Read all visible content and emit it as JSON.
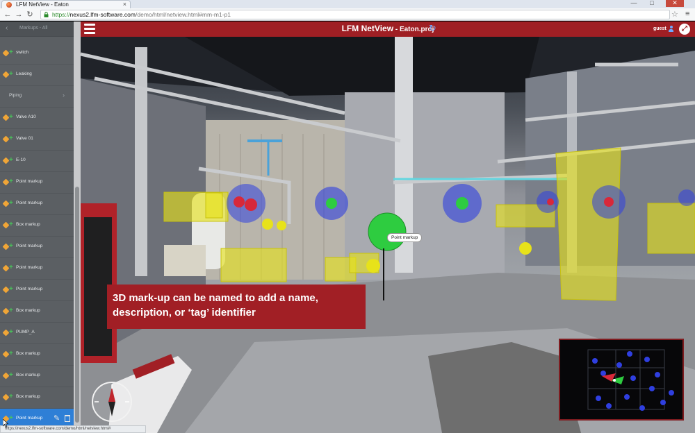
{
  "browser": {
    "tab_title": "LFM NetView - Eaton",
    "tab_close": "×",
    "url_scheme": "https://",
    "url_host": "nexus2.lfm-software.com",
    "url_rest": "/demo/html/netview.html#mm-m1-p1",
    "window_minimize": "—",
    "window_maximize": "□",
    "window_close": "✕",
    "back": "←",
    "forward": "→",
    "reload": "↻",
    "star": "☆",
    "menu": "≡"
  },
  "app": {
    "title": "LFM NetView",
    "separator": " - ",
    "project": "Eaton.proj",
    "refresh_glyph": "↻",
    "user": "guest",
    "fullscreen_glyph": "⤢"
  },
  "sidebar": {
    "back_glyph": "‹",
    "breadcrumb": "Markups - All",
    "items": [
      {
        "label": "switch",
        "type": "markup"
      },
      {
        "label": "Leaking",
        "type": "markup"
      },
      {
        "label": "Piping",
        "type": "category"
      },
      {
        "label": "Valve A10",
        "type": "markup"
      },
      {
        "label": "Valve 01",
        "type": "markup"
      },
      {
        "label": "E-10",
        "type": "markup"
      },
      {
        "label": "Point markup",
        "type": "markup"
      },
      {
        "label": "Point markup",
        "type": "markup"
      },
      {
        "label": "Box markup",
        "type": "markup"
      },
      {
        "label": "Point markup",
        "type": "markup"
      },
      {
        "label": "Point markup",
        "type": "markup"
      },
      {
        "label": "Point markup",
        "type": "markup"
      },
      {
        "label": "Box markup",
        "type": "markup"
      },
      {
        "label": "PUMP_A",
        "type": "markup"
      },
      {
        "label": "Box markup",
        "type": "markup"
      },
      {
        "label": "Box markup",
        "type": "markup"
      },
      {
        "label": "Box markup",
        "type": "markup"
      },
      {
        "label": "Point markup",
        "type": "markup",
        "selected": true
      }
    ],
    "plus_glyph": "+",
    "chevron_glyph": "›",
    "edit_glyph": "✎"
  },
  "viewport": {
    "tooltip": "Point markup",
    "caption_line1": "3D mark-up can be named to add a name,",
    "caption_line2": "description, or ‘tag’ identifier"
  },
  "status": {
    "url": "https://nexus2.lfm-software.com/demo/html/netview.html#"
  },
  "colors": {
    "brand_red": "#9f1f24",
    "selection_blue": "#2e7fd6",
    "markup_yellow": "#e7e21a",
    "markup_green": "#2ecc40",
    "markup_blue": "#2f3fe0",
    "markup_red": "#d8283a"
  }
}
